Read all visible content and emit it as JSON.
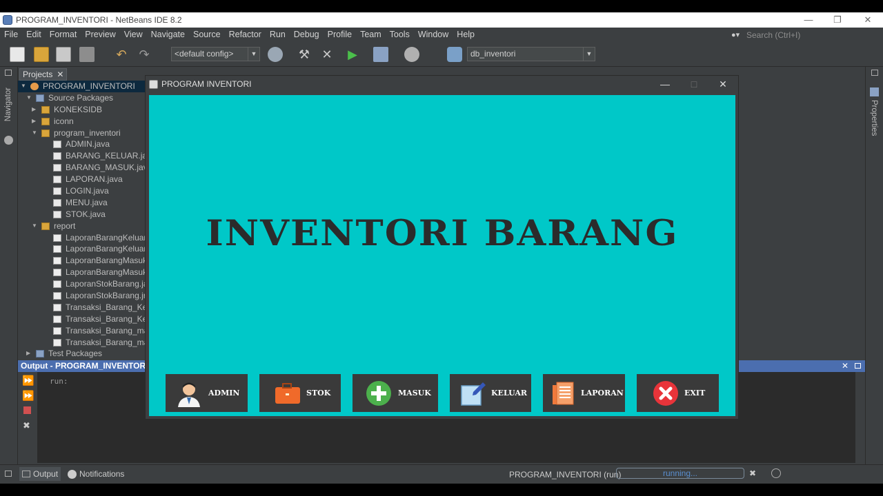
{
  "ide": {
    "title": "PROGRAM_INVENTORI - NetBeans IDE 8.2",
    "menu": [
      "File",
      "Edit",
      "Format",
      "Preview",
      "View",
      "Navigate",
      "Source",
      "Refactor",
      "Run",
      "Debug",
      "Profile",
      "Team",
      "Tools",
      "Window",
      "Help"
    ],
    "search_placeholder": "Search (Ctrl+I)",
    "config_combo": "<default config>",
    "db_combo": "db_inventori",
    "navigator_label": "Navigator",
    "properties_label": "Properties"
  },
  "projects": {
    "tab_label": "Projects",
    "tree": [
      {
        "label": "PROGRAM_INVENTORI",
        "level": 0,
        "toggle": "▼",
        "icon": "proj",
        "selected": true
      },
      {
        "label": "Source Packages",
        "level": 1,
        "toggle": "▼",
        "icon": "src"
      },
      {
        "label": "KONEKSIDB",
        "level": 2,
        "toggle": "▶",
        "icon": "pkg"
      },
      {
        "label": "iconn",
        "level": 2,
        "toggle": "▶",
        "icon": "pkg"
      },
      {
        "label": "program_inventori",
        "level": 2,
        "toggle": "▼",
        "icon": "pkg"
      },
      {
        "label": "ADMIN.java",
        "level": 3,
        "icon": "java"
      },
      {
        "label": "BARANG_KELUAR.java",
        "level": 3,
        "icon": "java"
      },
      {
        "label": "BARANG_MASUK.java",
        "level": 3,
        "icon": "java"
      },
      {
        "label": "LAPORAN.java",
        "level": 3,
        "icon": "java"
      },
      {
        "label": "LOGIN.java",
        "level": 3,
        "icon": "java"
      },
      {
        "label": "MENU.java",
        "level": 3,
        "icon": "java"
      },
      {
        "label": "STOK.java",
        "level": 3,
        "icon": "java"
      },
      {
        "label": "report",
        "level": 2,
        "toggle": "▼",
        "icon": "pkg"
      },
      {
        "label": "LaporanBarangKeluar.ja",
        "level": 3,
        "icon": "jas"
      },
      {
        "label": "LaporanBarangKeluar.jr",
        "level": 3,
        "icon": "jas"
      },
      {
        "label": "LaporanBarangMasuk.ja",
        "level": 3,
        "icon": "jas"
      },
      {
        "label": "LaporanBarangMasuk.jr",
        "level": 3,
        "icon": "jas"
      },
      {
        "label": "LaporanStokBarang.jas",
        "level": 3,
        "icon": "jas"
      },
      {
        "label": "LaporanStokBarang.jrxr",
        "level": 3,
        "icon": "jas"
      },
      {
        "label": "Transaksi_Barang_Kelu",
        "level": 3,
        "icon": "jas"
      },
      {
        "label": "Transaksi_Barang_Kelu",
        "level": 3,
        "icon": "jas"
      },
      {
        "label": "Transaksi_Barang_mas",
        "level": 3,
        "icon": "jas"
      },
      {
        "label": "Transaksi_Barang_mas",
        "level": 3,
        "icon": "jas"
      },
      {
        "label": "Test Packages",
        "level": 1,
        "toggle": "▶",
        "icon": "src"
      }
    ]
  },
  "output": {
    "title": "Output - PROGRAM_INVENTORI (r",
    "text": "run:"
  },
  "status": {
    "output_tab": "Output",
    "notifications_tab": "Notifications",
    "task": "PROGRAM_INVENTORI (run)",
    "progress": "running..."
  },
  "app": {
    "title": "PROGRAM INVENTORI",
    "heading": "INVENTORI BARANG",
    "bg_color": "#00c8c8",
    "buttons": [
      {
        "label": "ADMIN",
        "icon": "user-icon"
      },
      {
        "label": "STOK",
        "icon": "briefcase-icon"
      },
      {
        "label": "MASUK",
        "icon": "plus-circle-icon"
      },
      {
        "label": "KELUAR",
        "icon": "edit-icon"
      },
      {
        "label": "LAPORAN",
        "icon": "report-icon"
      },
      {
        "label": "EXIT",
        "icon": "close-circle-icon"
      }
    ]
  }
}
